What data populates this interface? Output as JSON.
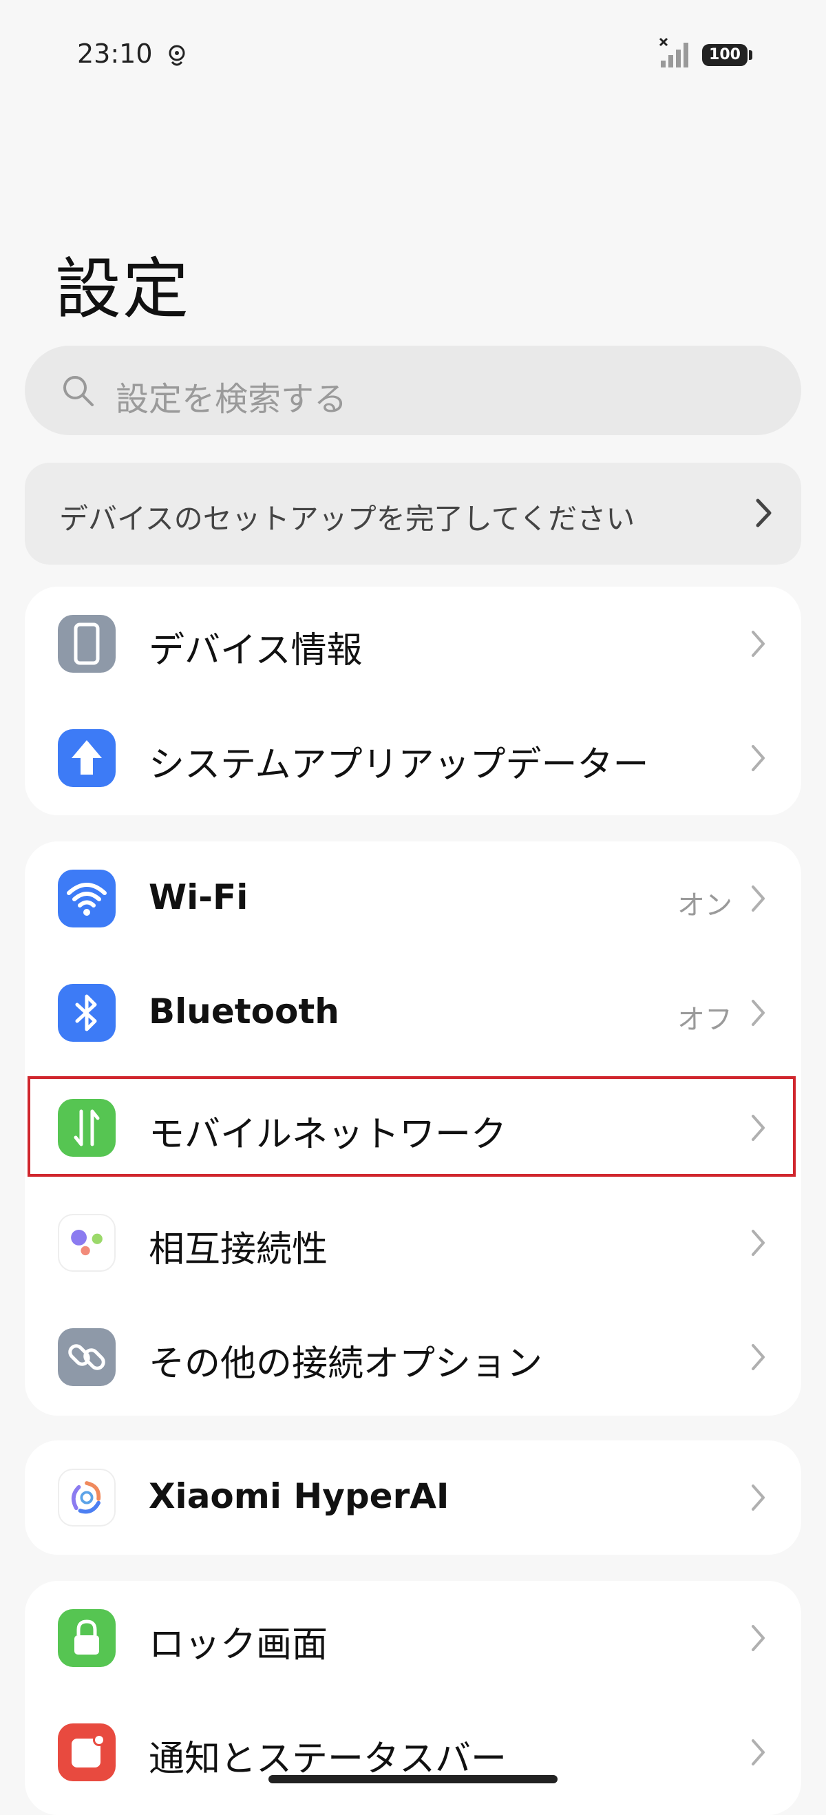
{
  "status": {
    "time": "23:10",
    "battery": "100"
  },
  "page": {
    "title": "設定"
  },
  "search": {
    "placeholder": "設定を検索する"
  },
  "setup_banner": {
    "text": "デバイスのセットアップを完了してください"
  },
  "groups": [
    {
      "items": [
        {
          "label": "デバイス情報",
          "icon": "phone-icon"
        },
        {
          "label": "システムアプリアップデーター",
          "icon": "arrow-up-icon"
        }
      ]
    },
    {
      "items": [
        {
          "label": "Wi-Fi",
          "value": "オン",
          "icon": "wifi-icon"
        },
        {
          "label": "Bluetooth",
          "value": "オフ",
          "icon": "bluetooth-icon"
        },
        {
          "label": "モバイルネットワーク",
          "icon": "mobile-data-icon"
        },
        {
          "label": "相互接続性",
          "icon": "interconnect-icon"
        },
        {
          "label": "その他の接続オプション",
          "icon": "link-icon"
        }
      ]
    },
    {
      "items": [
        {
          "label": "Xiaomi HyperAI",
          "icon": "hyperai-icon"
        }
      ]
    },
    {
      "items": [
        {
          "label": "ロック画面",
          "icon": "lock-icon"
        },
        {
          "label": "通知とステータスバー",
          "icon": "notification-icon"
        }
      ]
    }
  ],
  "colors": {
    "accent_blue": "#3d7bf6",
    "green": "#56c552",
    "gray_icon": "#8e99a8",
    "red_icon": "#e84a3f",
    "highlight": "#d0262d"
  }
}
